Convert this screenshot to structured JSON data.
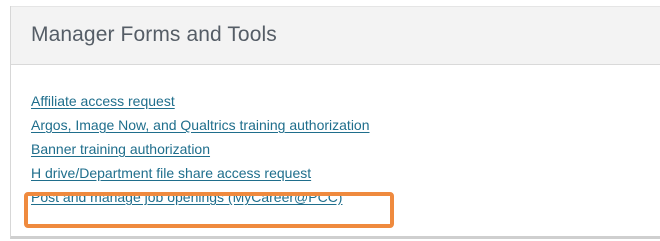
{
  "panel": {
    "title": "Manager Forms and Tools",
    "links": [
      {
        "label": "Affiliate access request"
      },
      {
        "label": "Argos, Image Now, and Qualtrics training authorization"
      },
      {
        "label": "Banner training authorization"
      },
      {
        "label": "H drive/Department file share access request"
      },
      {
        "label": "Post and manage job openings (MyCareer@PCC)"
      }
    ]
  },
  "colors": {
    "link": "#1f6e8c",
    "header_bg": "#f3f3f3",
    "title_text": "#555d66",
    "highlight": "#ef8a3e"
  }
}
